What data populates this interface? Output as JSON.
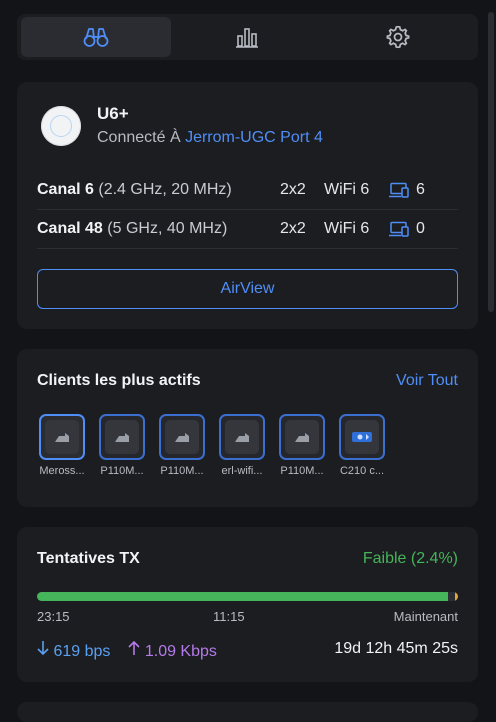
{
  "tabs": [
    {
      "icon": "binoculars-icon",
      "active": true
    },
    {
      "icon": "bar-chart-icon",
      "active": false
    },
    {
      "icon": "gear-icon",
      "active": false
    }
  ],
  "device": {
    "name": "U6+",
    "connected_prefix": "Connecté À",
    "uplink": "Jerrom-UGC Port 4"
  },
  "radios": [
    {
      "channel": "Canal 6",
      "detail": "(2.4 GHz, 20 MHz)",
      "mimo": "2x2",
      "standard": "WiFi 6",
      "clients": "6"
    },
    {
      "channel": "Canal 48",
      "detail": "(5 GHz, 40 MHz)",
      "mimo": "2x2",
      "standard": "WiFi 6",
      "clients": "0"
    }
  ],
  "airview_label": "AirView",
  "top_clients": {
    "title": "Clients les plus actifs",
    "see_all": "Voir Tout",
    "items": [
      {
        "label": "Meross...",
        "icon": "smart-plug-icon"
      },
      {
        "label": "P110M...",
        "icon": "smart-plug-icon"
      },
      {
        "label": "P110M...",
        "icon": "smart-plug-icon"
      },
      {
        "label": "erl-wifi...",
        "icon": "smart-plug-icon"
      },
      {
        "label": "P110M...",
        "icon": "smart-plug-icon"
      },
      {
        "label": "C210 c...",
        "icon": "camera-icon"
      }
    ]
  },
  "tx": {
    "title": "Tentatives TX",
    "status": "Faible (2.4%)",
    "retry_fraction": 0.024,
    "ticks": [
      "23:15",
      "11:15",
      "Maintenant"
    ],
    "down_rate": "619 bps",
    "up_rate": "1.09 Kbps",
    "uptime": "19d 12h 45m 25s",
    "colors": {
      "good": "#45b45a",
      "warn": "#e2a33b"
    }
  }
}
